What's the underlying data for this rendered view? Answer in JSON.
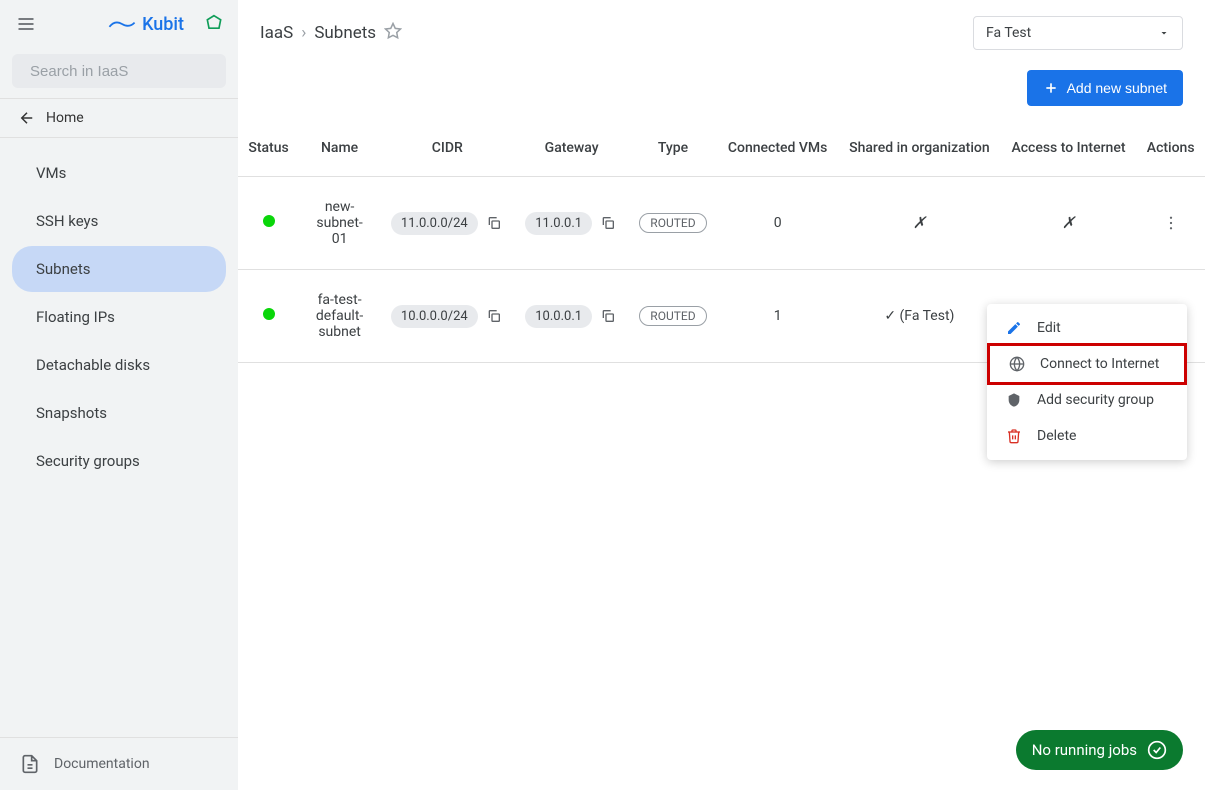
{
  "logo_text": "Kubit",
  "search_placeholder": "Search in IaaS",
  "home_label": "Home",
  "sidebar": {
    "items": [
      {
        "label": "VMs"
      },
      {
        "label": "SSH keys"
      },
      {
        "label": "Subnets"
      },
      {
        "label": "Floating IPs"
      },
      {
        "label": "Detachable disks"
      },
      {
        "label": "Snapshots"
      },
      {
        "label": "Security groups"
      }
    ]
  },
  "documentation_label": "Documentation",
  "breadcrumb": {
    "parent": "IaaS",
    "current": "Subnets"
  },
  "project": {
    "selected": "Fa Test"
  },
  "add_button_label": "Add new subnet",
  "columns": {
    "status": "Status",
    "name": "Name",
    "cidr": "CIDR",
    "gateway": "Gateway",
    "type": "Type",
    "connected": "Connected VMs",
    "shared": "Shared in organization",
    "access": "Access to Internet",
    "actions": "Actions"
  },
  "rows": [
    {
      "name": "new-subnet-01",
      "cidr": "11.0.0.0/24",
      "gateway": "11.0.0.1",
      "type": "ROUTED",
      "connected": "0",
      "shared": "✗",
      "access": "✗"
    },
    {
      "name": "fa-test-default-subnet",
      "cidr": "10.0.0.0/24",
      "gateway": "10.0.0.1",
      "type": "ROUTED",
      "connected": "1",
      "shared": "✓ (Fa Test)",
      "access": ""
    }
  ],
  "context_menu": {
    "edit": "Edit",
    "connect": "Connect to Internet",
    "security": "Add security group",
    "delete": "Delete"
  },
  "jobs_label": "No running jobs"
}
